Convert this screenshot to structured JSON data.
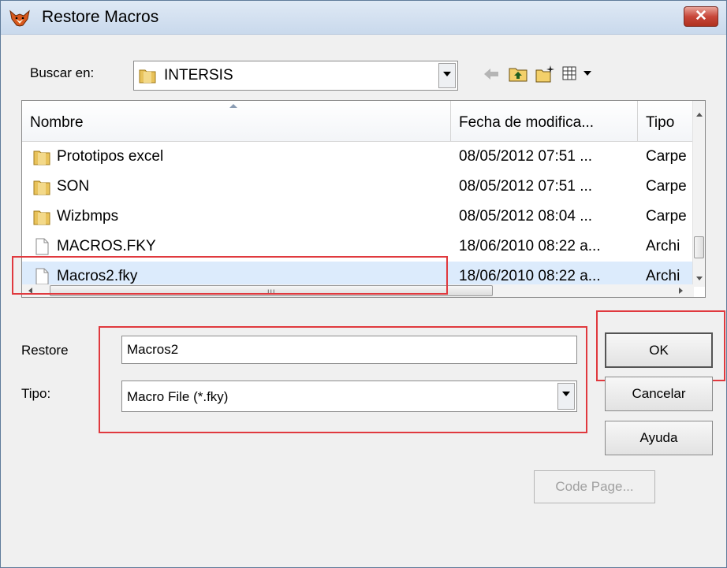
{
  "window": {
    "title": "Restore Macros",
    "close_glyph": "✕"
  },
  "look_in": {
    "label": "Buscar en:",
    "value": "INTERSIS"
  },
  "columns": [
    {
      "label": "Nombre"
    },
    {
      "label": "Fecha de modifica..."
    },
    {
      "label": "Tipo"
    }
  ],
  "files": [
    {
      "name": "Prototipos excel",
      "date": "08/05/2012 07:51 ...",
      "type": "Carpe",
      "icon": "folder-icon",
      "selected": false
    },
    {
      "name": "SON",
      "date": "08/05/2012 07:51 ...",
      "type": "Carpe",
      "icon": "folder-icon",
      "selected": false
    },
    {
      "name": "Wizbmps",
      "date": "08/05/2012 08:04 ...",
      "type": "Carpe",
      "icon": "folder-icon",
      "selected": false
    },
    {
      "name": "MACROS.FKY",
      "date": "18/06/2010 08:22 a...",
      "type": "Archi",
      "icon": "file-icon",
      "selected": false
    },
    {
      "name": "Macros2.fky",
      "date": "18/06/2010 08:22 a...",
      "type": "Archi",
      "icon": "file-icon",
      "selected": true
    }
  ],
  "scroll_grip": "III",
  "restore": {
    "label": "Restore",
    "value": "Macros2"
  },
  "tipo": {
    "label": "Tipo:",
    "value": "Macro File (*.fky)"
  },
  "buttons": {
    "ok": "OK",
    "cancel": "Cancelar",
    "help": "Ayuda",
    "code_page": "Code Page..."
  },
  "colors": {
    "highlight_box": "#e0393e",
    "selection": "#dcebfc",
    "folder": "#e8c25a"
  }
}
